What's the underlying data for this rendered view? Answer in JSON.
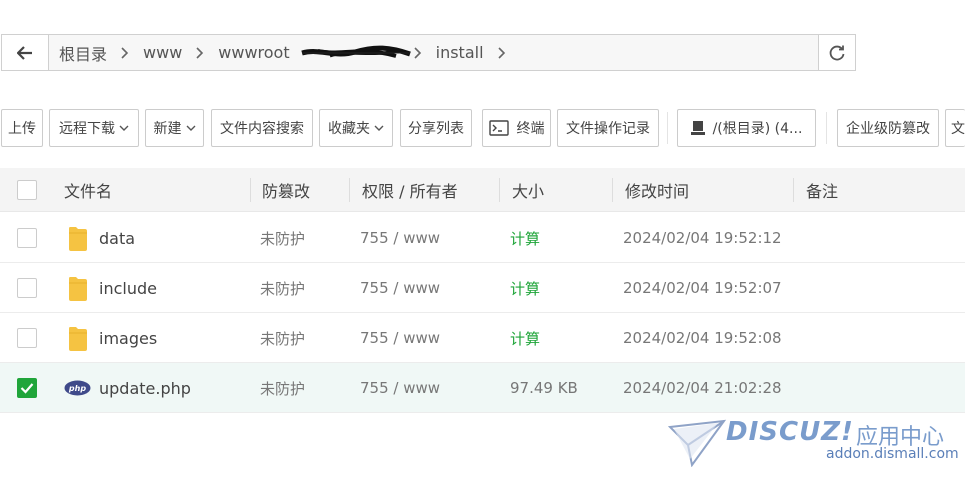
{
  "address_bar": {
    "crumbs": [
      "根目录",
      "www",
      "wwwroot",
      "",
      "install"
    ]
  },
  "toolbar": {
    "upload": "上传",
    "remote_download": "远程下载",
    "new": "新建",
    "content_search": "文件内容搜索",
    "favorites": "收藏夹",
    "share_list": "分享列表",
    "terminal": "终端",
    "op_log": "文件操作记录",
    "disk": "/(根目录) (4...",
    "tamper_proof": "企业级防篡改",
    "truncated": "文"
  },
  "table": {
    "headers": {
      "filename": "文件名",
      "tamper": "防篡改",
      "perm_owner": "权限 / 所有者",
      "size": "大小",
      "mtime": "修改时间",
      "note": "备注"
    },
    "rows": [
      {
        "name": "data",
        "type": "folder",
        "tamper": "未防护",
        "perm": "755 / www",
        "size": "计算",
        "mtime": "2024/02/04 19:52:12",
        "checked": false
      },
      {
        "name": "include",
        "type": "folder",
        "tamper": "未防护",
        "perm": "755 / www",
        "size": "计算",
        "mtime": "2024/02/04 19:52:07",
        "checked": false
      },
      {
        "name": "images",
        "type": "folder",
        "tamper": "未防护",
        "perm": "755 / www",
        "size": "计算",
        "mtime": "2024/02/04 19:52:08",
        "checked": false
      },
      {
        "name": "update.php",
        "type": "php",
        "tamper": "未防护",
        "perm": "755 / www",
        "size": "97.49 KB",
        "mtime": "2024/02/04 21:02:28",
        "checked": true
      }
    ]
  },
  "watermark": {
    "logo": "DISCUZ!",
    "app": "应用中心",
    "site": "addon.dismall.com"
  },
  "colors": {
    "accent_green": "#20a53a",
    "folder": "#f5c342",
    "php_badge": "#3f4a8a",
    "selected_row": "#f0f8f6"
  },
  "icons": {
    "back": "arrow-left-icon",
    "refresh": "refresh-icon",
    "folder": "folder-icon",
    "php": "php-file-icon",
    "terminal": "terminal-icon",
    "disk": "disk-icon"
  }
}
